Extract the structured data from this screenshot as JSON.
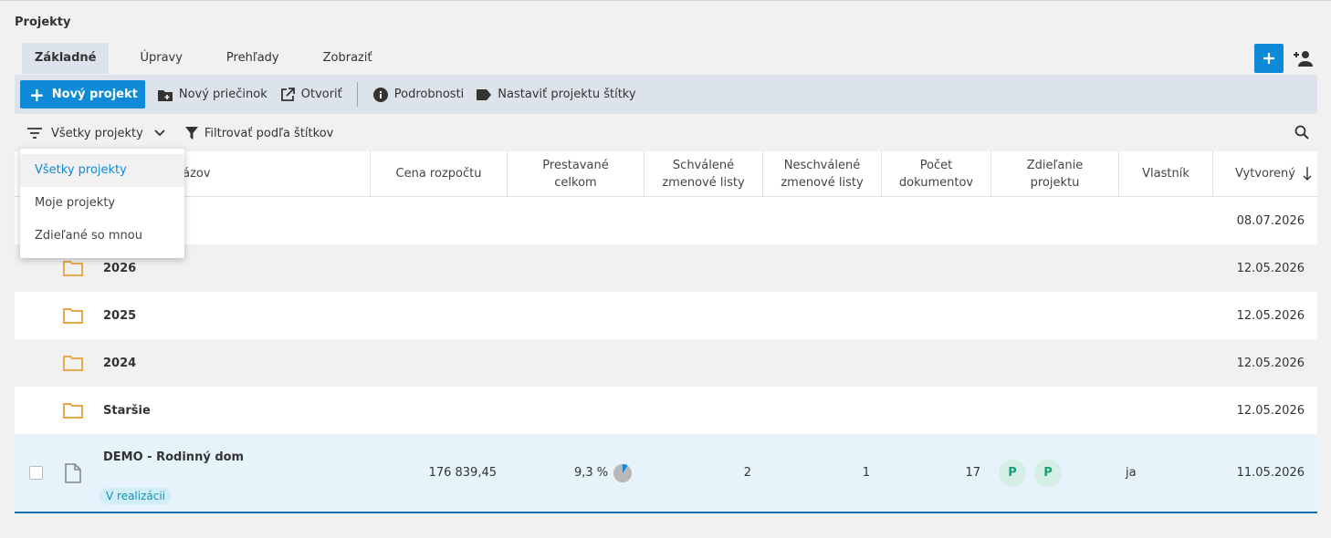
{
  "page": {
    "title": "Projekty"
  },
  "tabs": [
    {
      "label": "Základné",
      "active": true
    },
    {
      "label": "Úpravy"
    },
    {
      "label": "Prehľady"
    },
    {
      "label": "Zobraziť"
    }
  ],
  "toolbar": {
    "new_project": "Nový projekt",
    "new_folder": "Nový priečinok",
    "open": "Otvoriť",
    "details": "Podrobnosti",
    "set_tags": "Nastaviť projektu štítky"
  },
  "filter": {
    "current": "Všetky projekty",
    "by_tags": "Filtrovať podľa štítkov",
    "options": [
      "Všetky projekty",
      "Moje projekty",
      "Zdieľané so mnou"
    ]
  },
  "table": {
    "columns": {
      "name": "Názov",
      "budget": "Cena rozpočtu",
      "built_total_1": "Prestavané",
      "built_total_2": "celkom",
      "approved_1": "Schválené",
      "approved_2": "zmenové listy",
      "unapproved_1": "Neschválené",
      "unapproved_2": "zmenové listy",
      "docs_1": "Počet",
      "docs_2": "dokumentov",
      "sharing_1": "Zdieľanie",
      "sharing_2": "projektu",
      "owner": "Vlastník",
      "created": "Vytvorený"
    },
    "rows": [
      {
        "name": "",
        "created": "08.07.2026"
      },
      {
        "name": "2026",
        "created": "12.05.2026"
      },
      {
        "name": "2025",
        "created": "12.05.2026"
      },
      {
        "name": "2024",
        "created": "12.05.2026"
      },
      {
        "name": "Staršie",
        "created": "12.05.2026"
      }
    ],
    "demo": {
      "name": "DEMO - Rodinný dom",
      "status": "V realizácii",
      "budget": "176 839,45",
      "built_percent": "9,3 %",
      "built_fraction": 0.093,
      "approved": "2",
      "unapproved": "1",
      "docs": "17",
      "avatar1": "P",
      "avatar2": "P",
      "owner": "ja",
      "created": "11.05.2026"
    }
  },
  "colors": {
    "accent": "#0e8ad6",
    "folder": "#e8a94a",
    "avatar_bg": "#d5efe6",
    "avatar_text": "#19a07a"
  }
}
